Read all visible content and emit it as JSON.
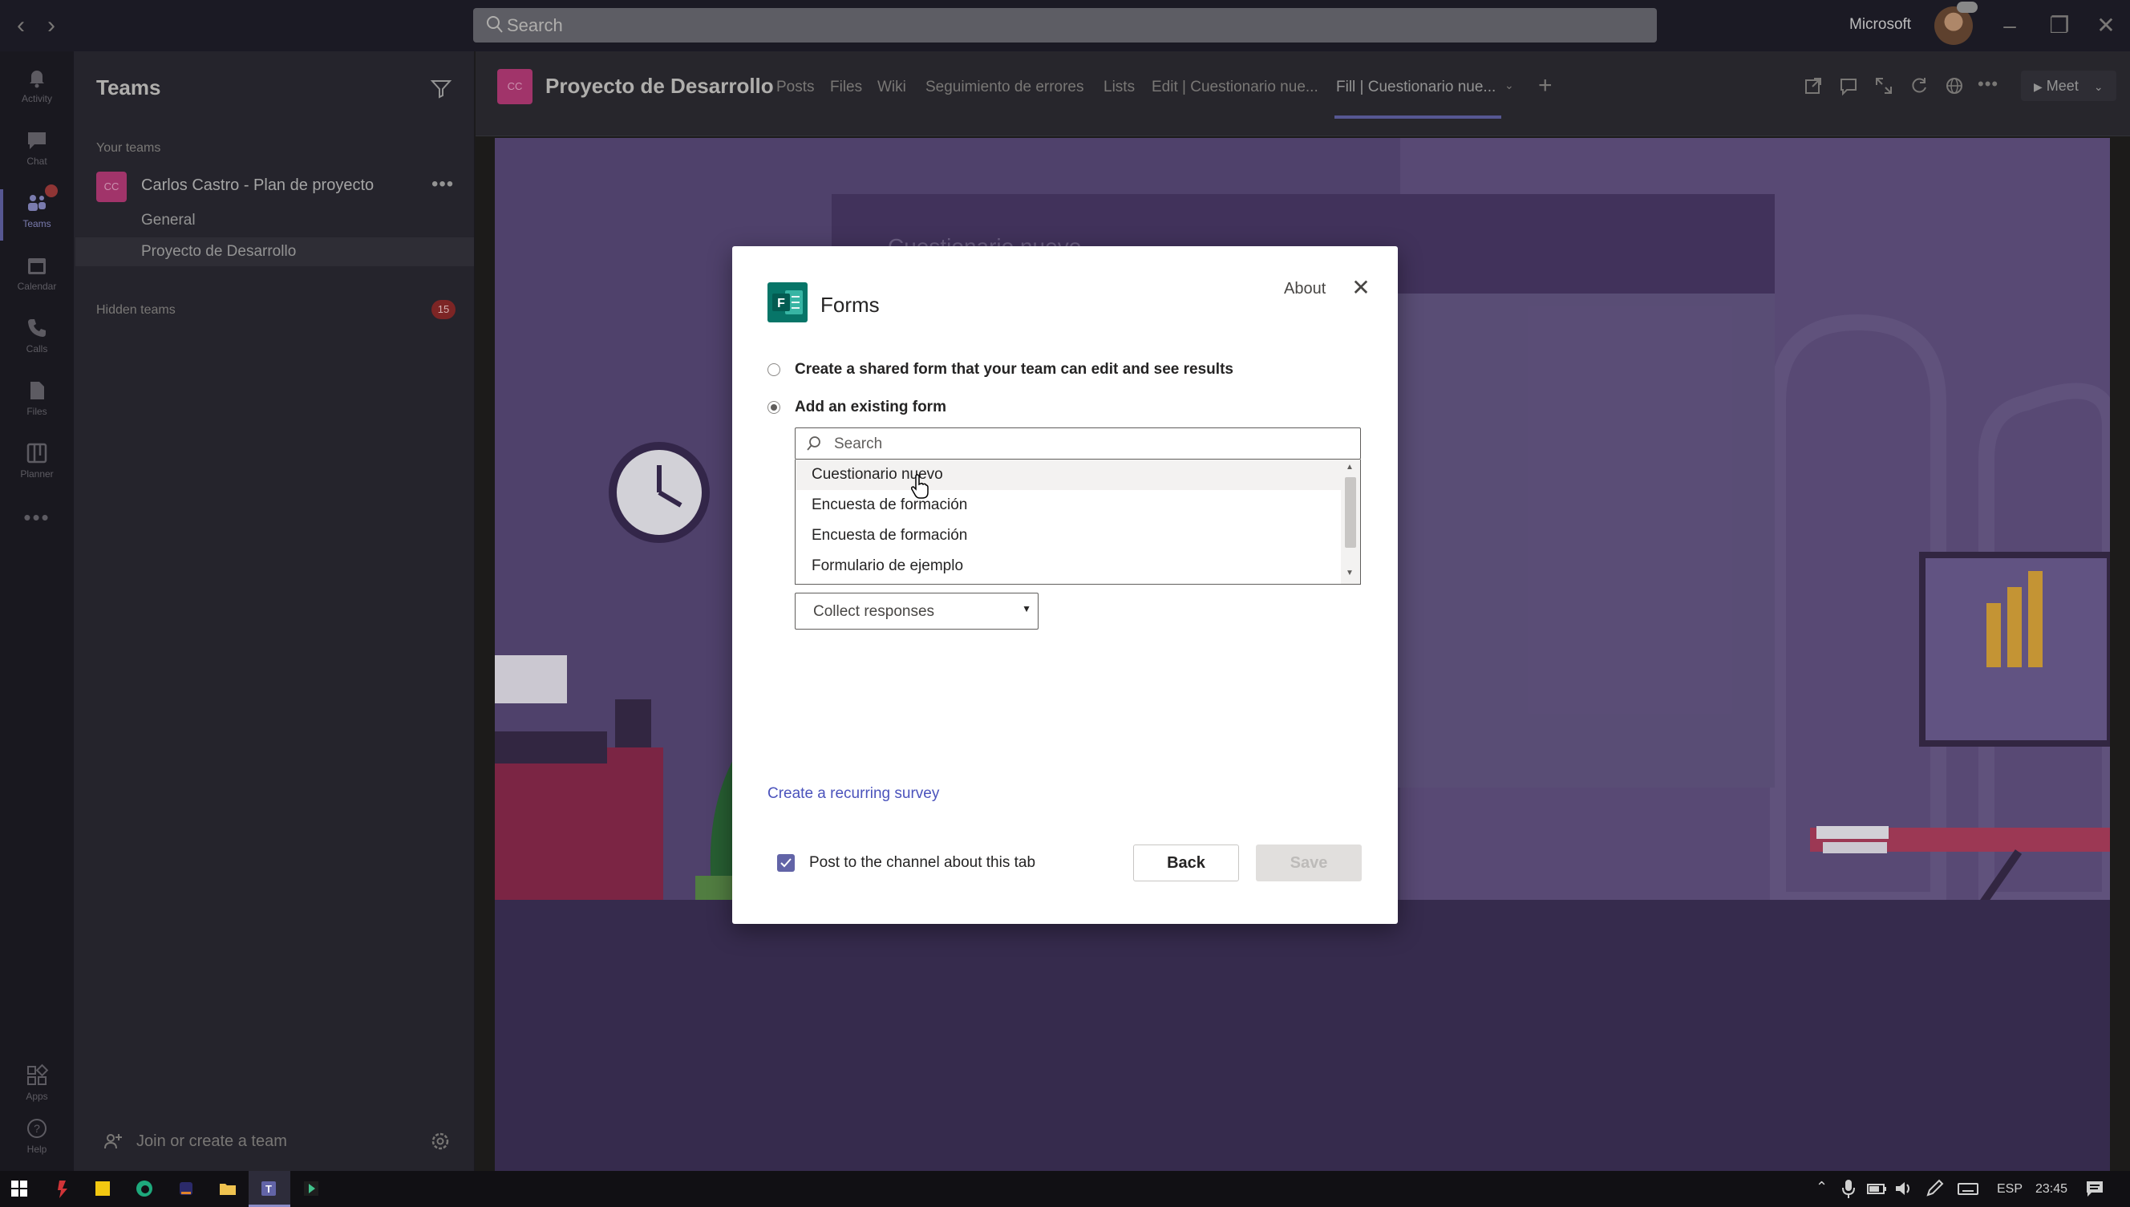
{
  "titlebar": {
    "search_placeholder": "Search",
    "org_name": "Microsoft"
  },
  "rail": {
    "items": [
      {
        "label": "Activity",
        "icon": "bell-icon"
      },
      {
        "label": "Chat",
        "icon": "chat-icon"
      },
      {
        "label": "Teams",
        "icon": "teams-icon"
      },
      {
        "label": "Calendar",
        "icon": "calendar-icon"
      },
      {
        "label": "Calls",
        "icon": "phone-icon"
      },
      {
        "label": "Files",
        "icon": "file-icon"
      },
      {
        "label": "Planner",
        "icon": "planner-icon"
      },
      {
        "label": "Apps",
        "icon": "apps-icon"
      },
      {
        "label": "Help",
        "icon": "help-icon"
      }
    ]
  },
  "left_panel": {
    "title": "Teams",
    "your_teams_label": "Your teams",
    "team": {
      "avatar": "CC",
      "name": "Carlos Castro - Plan de proyecto",
      "more": "•••",
      "channels": [
        "General",
        "Proyecto de Desarrollo"
      ]
    },
    "hidden_teams_label": "Hidden teams",
    "hidden_teams_count": "15",
    "join_label": "Join or create a team"
  },
  "channel_header": {
    "avatar": "CC",
    "title": "Proyecto de Desarrollo",
    "tabs": [
      "Posts",
      "Files",
      "Wiki",
      "Seguimiento de errores",
      "Lists",
      "Edit | Cuestionario nue...",
      "Fill | Cuestionario nue..."
    ],
    "active_tab_index": 6,
    "add_tab": "+",
    "meet_label": "Meet"
  },
  "background": {
    "card_title": "Cuestionario nuevo"
  },
  "dialog": {
    "title": "Forms",
    "about": "About",
    "close": "✕",
    "options": [
      {
        "label": "Create a shared form that your team can edit and see results",
        "checked": false
      },
      {
        "label": "Add an existing form",
        "checked": true
      }
    ],
    "search_placeholder": "Search",
    "forms": [
      "Cuestionario nuevo",
      "Encuesta de formación",
      "Encuesta de formación",
      "Formulario de ejemplo"
    ],
    "hovered_index": 0,
    "mode_select": "Collect responses",
    "recurring_link": "Create a recurring survey",
    "post_label": "Post to the channel about this tab",
    "post_checked": true,
    "back_label": "Back",
    "save_label": "Save"
  },
  "taskbar": {
    "language": "ESP",
    "time": "23:45"
  },
  "colors": {
    "accent": "#6264a7",
    "link": "#4b53bc",
    "badge": "#8f2b2b",
    "team_avatar": "#b83c79",
    "forms_green": "#077568"
  }
}
